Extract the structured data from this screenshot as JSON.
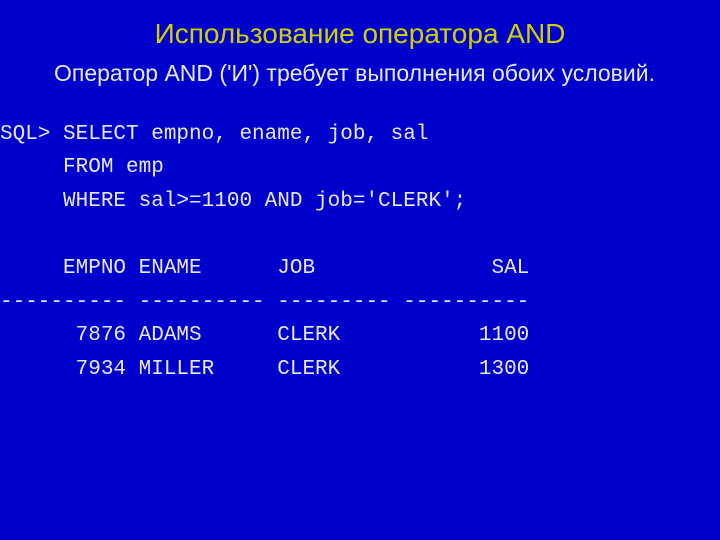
{
  "title": "Использование оператора AND",
  "description": "Оператор AND  ('И') требует выполнения обоих условий.",
  "sql": {
    "line1": "SQL> SELECT empno, ename, job, sal",
    "line2": "     FROM emp",
    "line3": "     WHERE sal>=1100 AND job='CLERK';",
    "blank": "",
    "header": "     EMPNO ENAME      JOB              SAL",
    "divider": "---------- ---------- --------- ----------",
    "row1": "      7876 ADAMS      CLERK           1100",
    "row2": "      7934 MILLER     CLERK           1300"
  },
  "chart_data": {
    "type": "table",
    "title": "SQL query result",
    "columns": [
      "EMPNO",
      "ENAME",
      "JOB",
      "SAL"
    ],
    "rows": [
      {
        "EMPNO": 7876,
        "ENAME": "ADAMS",
        "JOB": "CLERK",
        "SAL": 1100
      },
      {
        "EMPNO": 7934,
        "ENAME": "MILLER",
        "JOB": "CLERK",
        "SAL": 1300
      }
    ]
  }
}
